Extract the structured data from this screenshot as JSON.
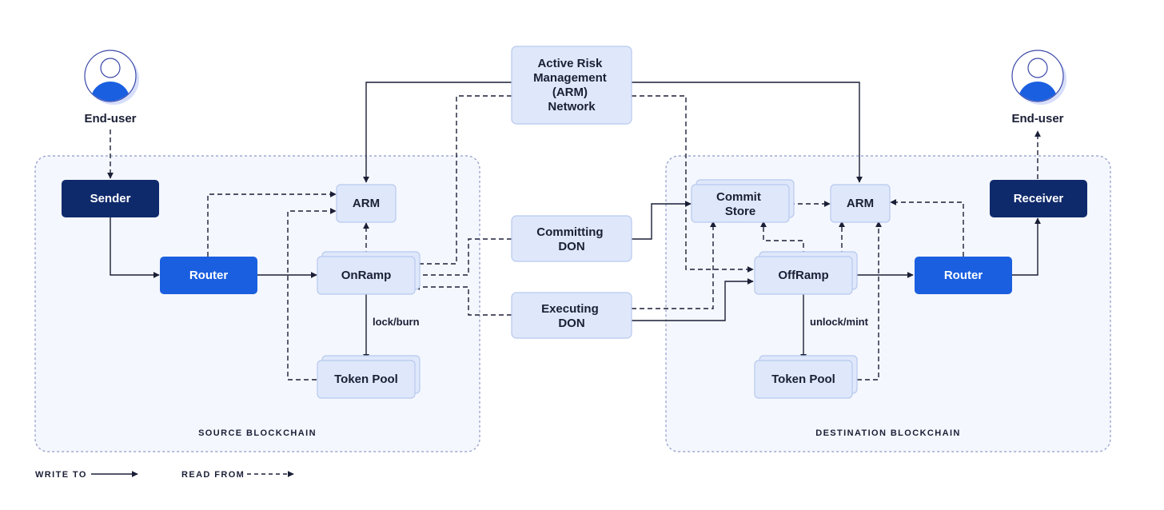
{
  "colors": {
    "dark_node": "#0f2a6b",
    "router": "#1a5fe0",
    "light_node_fill": "#dfe8fb",
    "light_node_border": "#b8c9ee",
    "region_fill": "#f4f7fd",
    "region_border": "#8f98c8",
    "line": "#1a1f36"
  },
  "users": {
    "source": {
      "label": "End-user",
      "icon": "user-avatar-icon"
    },
    "destination": {
      "label": "End-user",
      "icon": "user-avatar-icon"
    }
  },
  "regions": {
    "source": {
      "label": "SOURCE BLOCKCHAIN"
    },
    "destination": {
      "label": "DESTINATION BLOCKCHAIN"
    }
  },
  "external": {
    "arm_network": {
      "lines": [
        "Active Risk",
        "Management",
        "(ARM)",
        "Network"
      ]
    },
    "committing_don": {
      "lines": [
        "Committing",
        "DON"
      ]
    },
    "executing_don": {
      "lines": [
        "Executing",
        "DON"
      ]
    }
  },
  "source_nodes": {
    "sender": "Sender",
    "router": "Router",
    "arm": "ARM",
    "onramp": "OnRamp",
    "token_pool": "Token Pool",
    "edge_label": "lock/burn"
  },
  "destination_nodes": {
    "commit_store": [
      "Commit",
      "Store"
    ],
    "arm": "ARM",
    "offramp": "OffRamp",
    "token_pool": "Token Pool",
    "router": "Router",
    "receiver": "Receiver",
    "edge_label": "unlock/mint"
  },
  "legend": {
    "write_to": "WRITE TO",
    "read_from": "READ FROM"
  }
}
